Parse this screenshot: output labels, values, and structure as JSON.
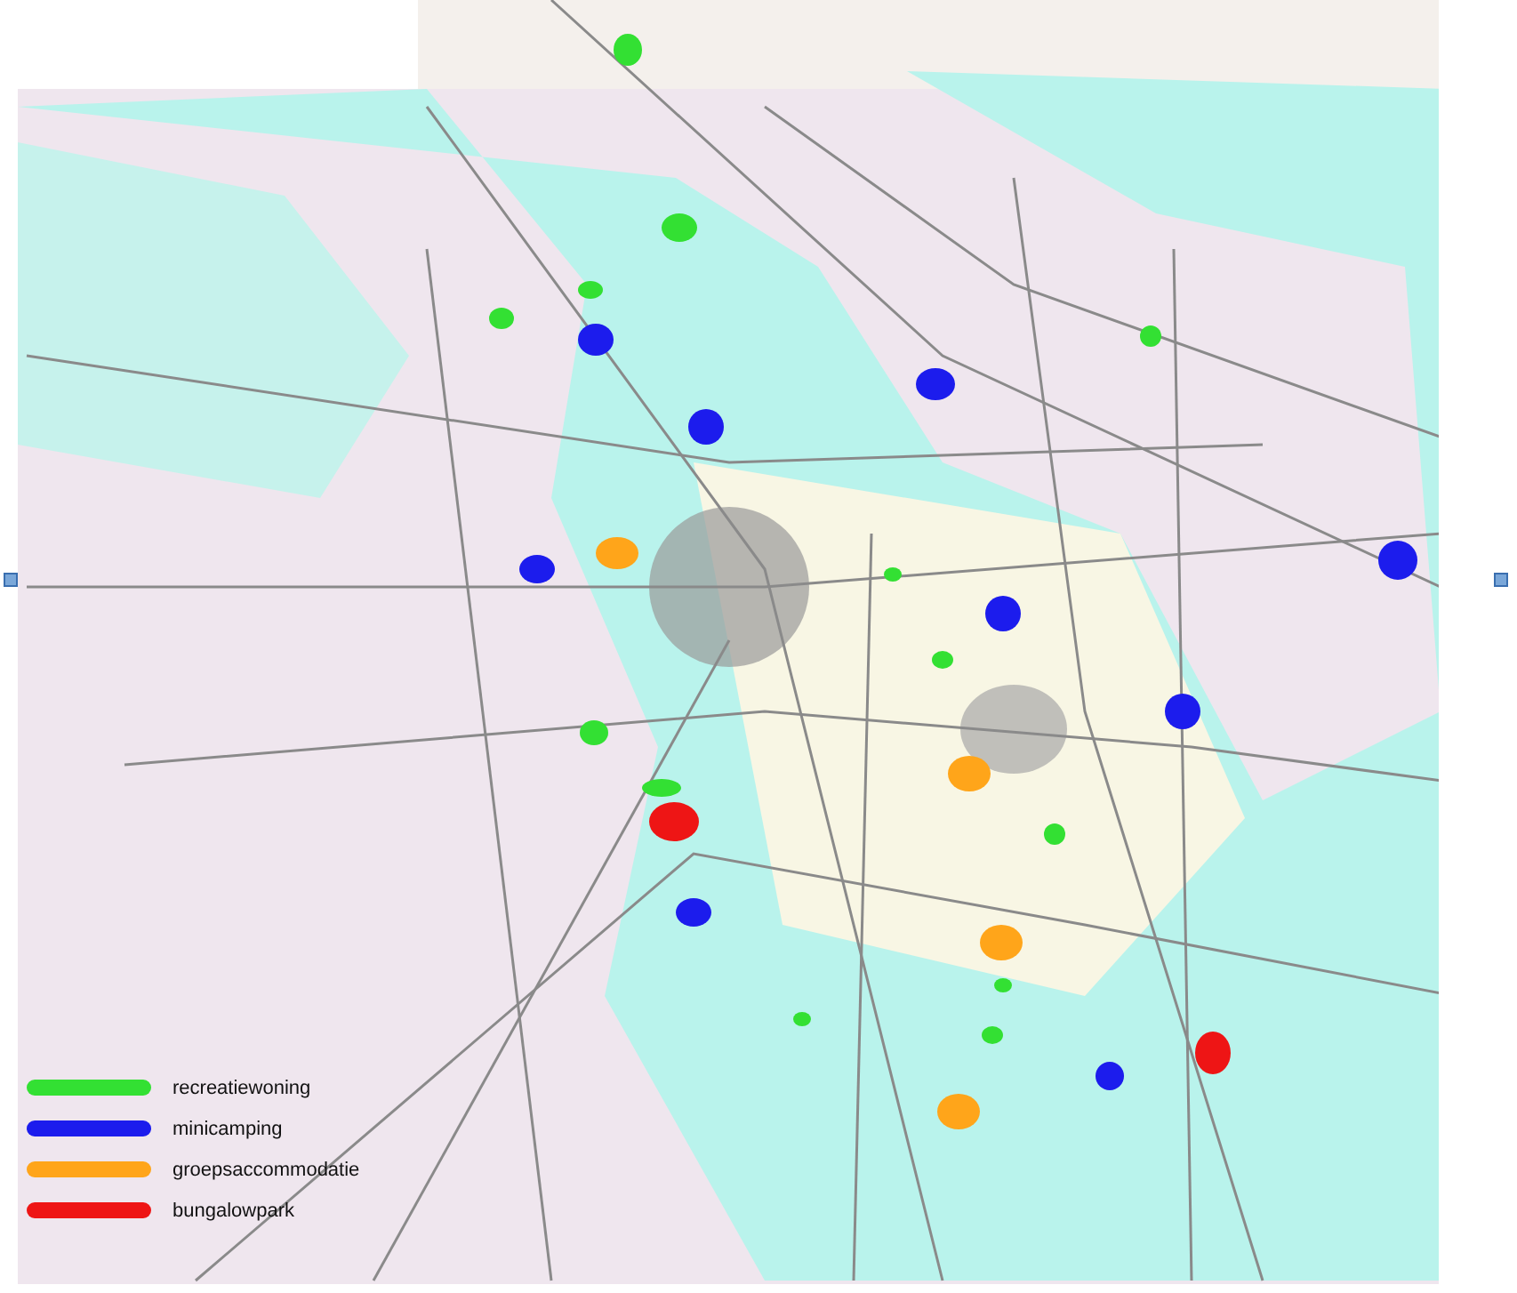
{
  "legend": [
    {
      "label": "recreatiewoning",
      "color": "#33e033"
    },
    {
      "label": "minicamping",
      "color": "#1c1ced"
    },
    {
      "label": "groepsaccommodatie",
      "color": "#ffa51a"
    },
    {
      "label": "bungalowpark",
      "color": "#ee1515"
    }
  ]
}
